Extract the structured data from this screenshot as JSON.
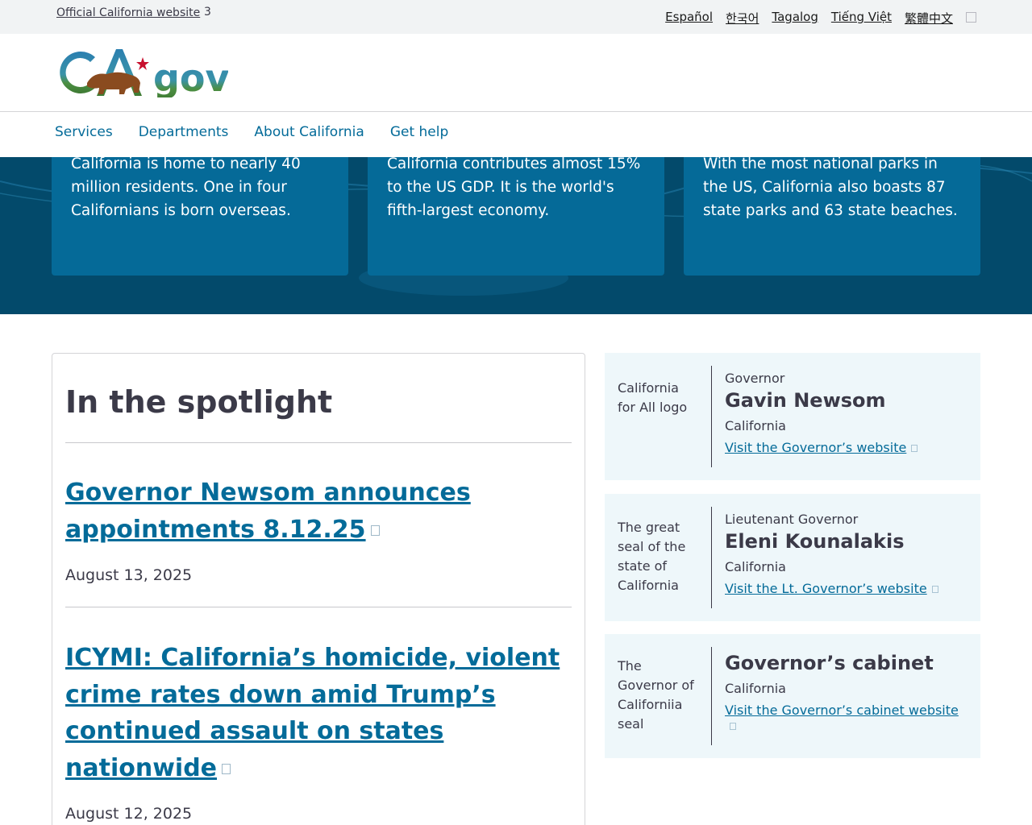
{
  "utility": {
    "official_label": "Official California website",
    "official_chevron": "3",
    "languages": [
      "Español",
      "한국어",
      "Tagalog",
      "Tiếng Việt",
      "繁體中文"
    ]
  },
  "header": {
    "logo_text": "CA.gov"
  },
  "nav": {
    "items": [
      "Services",
      "Departments",
      "About California",
      "Get help"
    ]
  },
  "hero": {
    "cards": [
      "California is home to nearly 40 million residents. One in four Californians is born overseas.",
      "California contributes almost 15% to the US GDP. It is the world's fifth-largest economy.",
      "With the most national parks in the US, California also boasts 87 state parks and 63 state beaches."
    ]
  },
  "spotlight": {
    "title": "In the spotlight",
    "items": [
      {
        "headline": "Governor Newsom announces appointments 8.12.25",
        "date": "August 13, 2025"
      },
      {
        "headline": "ICYMI: California’s homicide, violent crime rates down amid Trump’s continued assault on states nationwide",
        "date": "August 12, 2025"
      }
    ]
  },
  "officials": [
    {
      "image_alt": "California for All logo",
      "role": "Governor",
      "name": "Gavin Newsom",
      "place": "California",
      "link": "Visit the Governor’s website"
    },
    {
      "image_alt": "The great seal of the state of California",
      "role": "Lieutenant Governor",
      "name": "Eleni Kounalakis",
      "place": "California",
      "link": "Visit the Lt. Governor’s website"
    },
    {
      "image_alt": "The Governor of Californiia seal",
      "role": "",
      "name": "Governor’s cabinet",
      "place": "California",
      "link": "Visit the Governor’s cabinet website"
    }
  ],
  "colors": {
    "link": "#046b99",
    "hero_bg": "#034a6b",
    "card_bg": "#056a98",
    "official_bg": "#eef7fa",
    "star": "#c8102e"
  }
}
